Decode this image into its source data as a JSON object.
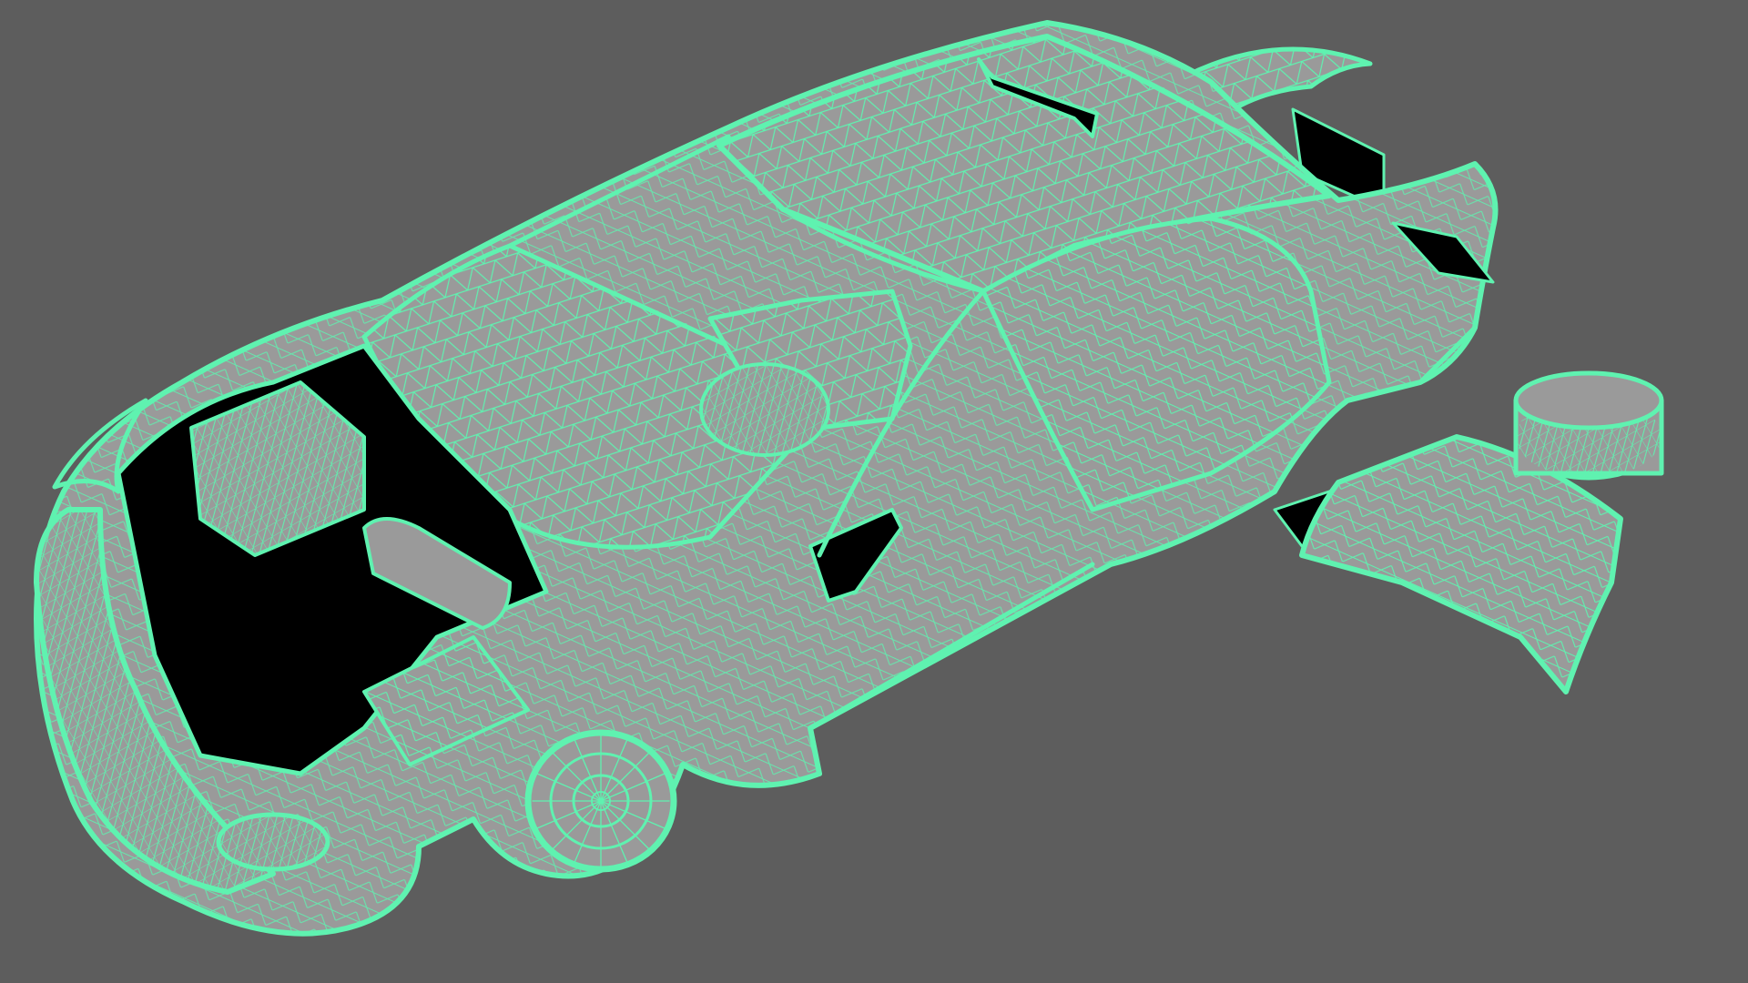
{
  "viewport": {
    "background": "#5d5d5d",
    "render_mode": "wireframe-on-shaded"
  },
  "model": {
    "subject": "car",
    "wire_color": "#5ff2b0",
    "panel_color": "#9a9a9a",
    "void_color": "#000000",
    "parts": [
      "body-shell",
      "roof",
      "hood-open",
      "engine-block",
      "rear-wing",
      "door-open-right",
      "front-wheel",
      "rear-wheel",
      "seat",
      "steering-wheel",
      "side-mirror",
      "interior-frame"
    ]
  }
}
